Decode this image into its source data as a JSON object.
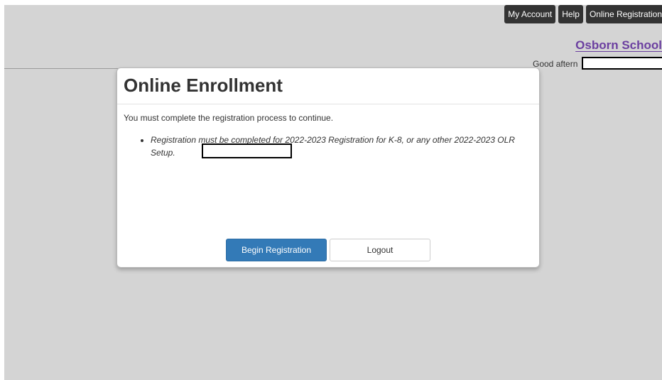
{
  "topnav": {
    "items": [
      {
        "label": "My Account"
      },
      {
        "label": "Help"
      },
      {
        "label": "Online Registration"
      }
    ]
  },
  "header": {
    "school_name": "Osborn School",
    "greeting": "Good aftern"
  },
  "modal": {
    "title": "Online Enrollment",
    "message": "You must complete the registration process to continue.",
    "requirements": [
      {
        "text": "Registration must be completed for 2022-2023 Registration for K-8, or any other 2022-2023 OLR Setup."
      }
    ],
    "buttons": {
      "begin_label": "Begin Registration",
      "logout_label": "Logout"
    }
  },
  "colors": {
    "page_background": "#d4d4d4",
    "nav_background": "#333333",
    "school_name": "#6b3fa0",
    "primary_button": "#337ab7"
  }
}
